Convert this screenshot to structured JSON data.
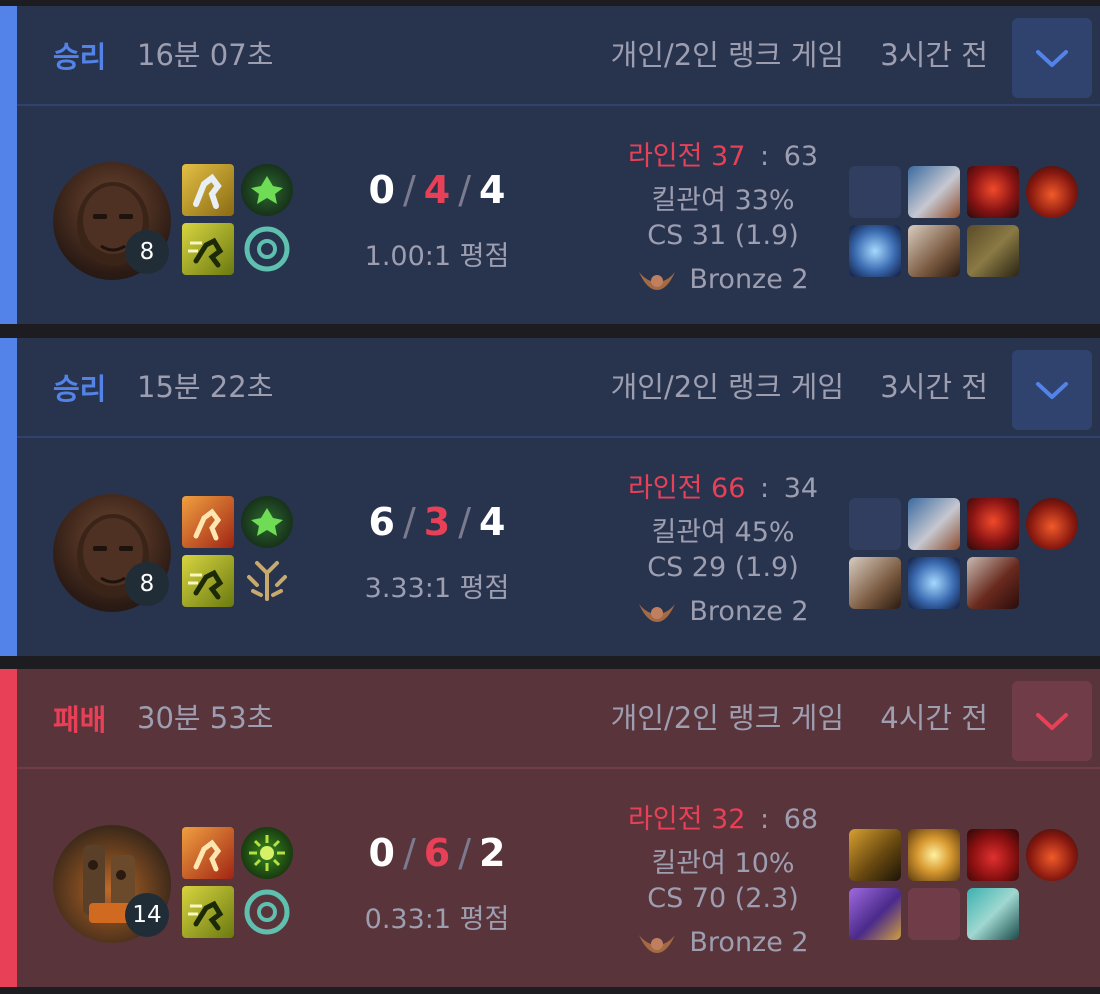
{
  "matches": [
    {
      "result": "승리",
      "duration": "16분 07초",
      "queue": "개인/2인 랭크 게임",
      "time_ago": "3시간 전",
      "champion_level": "8",
      "kda": {
        "kills": "0",
        "deaths": "4",
        "assists": "4"
      },
      "kda_ratio": "1.00:1 평점",
      "lane_label": "라인전 37",
      "lane_separator": ":",
      "lane_opp": "63",
      "kill_participation": "킬관여 33%",
      "cs": "CS 31 (1.9)",
      "tier": "Bronze 2"
    },
    {
      "result": "승리",
      "duration": "15분 22초",
      "queue": "개인/2인 랭크 게임",
      "time_ago": "3시간 전",
      "champion_level": "8",
      "kda": {
        "kills": "6",
        "deaths": "3",
        "assists": "4"
      },
      "kda_ratio": "3.33:1 평점",
      "lane_label": "라인전 66",
      "lane_separator": ":",
      "lane_opp": "34",
      "kill_participation": "킬관여 45%",
      "cs": "CS 29 (1.9)",
      "tier": "Bronze 2"
    },
    {
      "result": "패배",
      "duration": "30분 53초",
      "queue": "개인/2인 랭크 게임",
      "time_ago": "4시간 전",
      "champion_level": "14",
      "kda": {
        "kills": "0",
        "deaths": "6",
        "assists": "2"
      },
      "kda_ratio": "0.33:1 평점",
      "lane_label": "라인전 32",
      "lane_separator": ":",
      "lane_opp": "68",
      "kill_participation": "킬관여 10%",
      "cs": "CS 70 (2.3)",
      "tier": "Bronze 2"
    }
  ],
  "colors": {
    "win": "#5383e8",
    "loss": "#e84057",
    "text_muted": "#9e9eb1",
    "card_win": "#28344e",
    "card_loss": "#59343b"
  }
}
